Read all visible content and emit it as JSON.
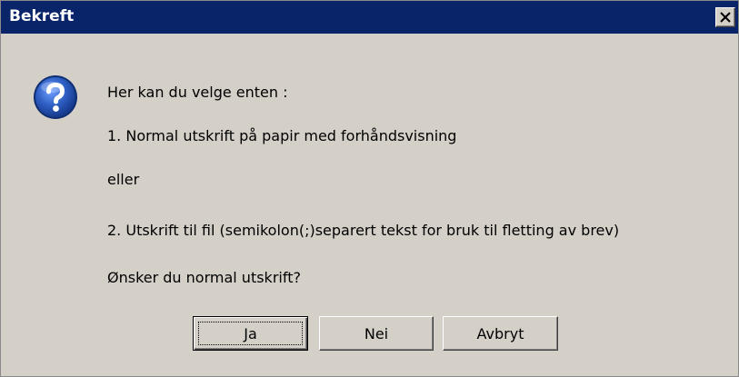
{
  "window": {
    "title": "Bekreft"
  },
  "icons": {
    "close": "close-icon",
    "question": "question-icon"
  },
  "colors": {
    "titlebar": "#0a246a",
    "dialog_background": "#d4d0c8",
    "question_icon_blue": "#1f4fa8"
  },
  "message": {
    "line1": "Her kan du velge enten :",
    "line2": "1. Normal utskrift på papir med forhåndsvisning",
    "line3": "eller",
    "line4": "2. Utskrift til fil (semikolon(;)separert tekst for bruk til fletting av brev)",
    "line5": "Ønsker du normal utskrift?"
  },
  "buttons": {
    "yes": "Ja",
    "no": "Nei",
    "cancel": "Avbryt"
  }
}
